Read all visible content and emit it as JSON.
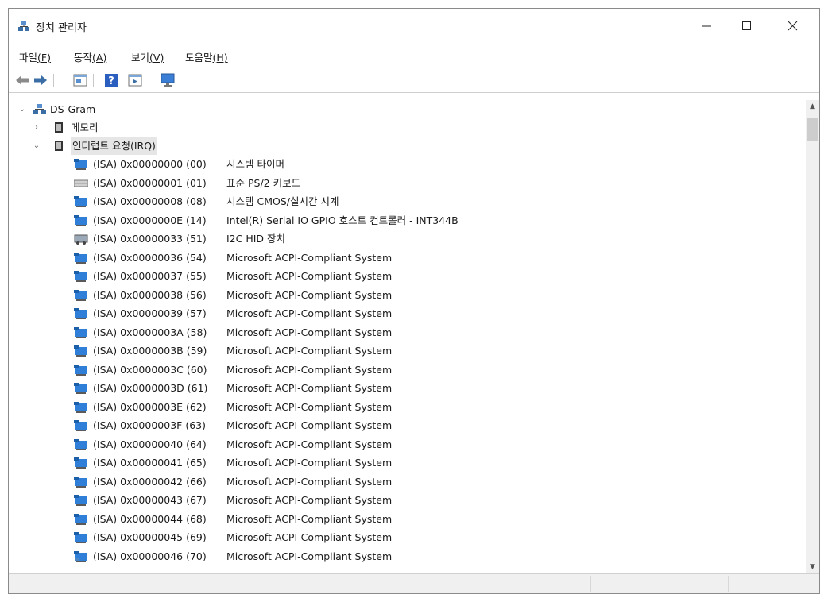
{
  "window": {
    "title": "장치 관리자",
    "icon": "computer-icon"
  },
  "menu": [
    {
      "label": "파일",
      "accel": "(F)"
    },
    {
      "label": "동작",
      "accel": "(A)"
    },
    {
      "label": "보기",
      "accel": "(V)"
    },
    {
      "label": "도움말",
      "accel": "(H)"
    }
  ],
  "toolbar": [
    "back-icon",
    "forward-icon",
    "properties-icon",
    "help-icon",
    "view-icon",
    "monitor-icon"
  ],
  "tree": {
    "root": "DS-Gram",
    "nodes": [
      {
        "label": "메모리",
        "expanded": false
      },
      {
        "label": "인터럽트 요청(IRQ)",
        "expanded": true,
        "selected": true
      }
    ],
    "irq": [
      {
        "irq": "(ISA) 0x00000000 (00)",
        "device": "시스템 타이머",
        "icon": "monitor"
      },
      {
        "irq": "(ISA) 0x00000001 (01)",
        "device": "표준 PS/2 키보드",
        "icon": "keyboard"
      },
      {
        "irq": "(ISA) 0x00000008 (08)",
        "device": "시스템 CMOS/실시간 시계",
        "icon": "monitor"
      },
      {
        "irq": "(ISA) 0x0000000E (14)",
        "device": "Intel(R) Serial IO GPIO 호스트 컨트롤러 - INT344B",
        "icon": "monitor"
      },
      {
        "irq": "(ISA) 0x00000033 (51)",
        "device": "I2C HID 장치",
        "icon": "hid"
      },
      {
        "irq": "(ISA) 0x00000036 (54)",
        "device": "Microsoft ACPI-Compliant System",
        "icon": "monitor"
      },
      {
        "irq": "(ISA) 0x00000037 (55)",
        "device": "Microsoft ACPI-Compliant System",
        "icon": "monitor"
      },
      {
        "irq": "(ISA) 0x00000038 (56)",
        "device": "Microsoft ACPI-Compliant System",
        "icon": "monitor"
      },
      {
        "irq": "(ISA) 0x00000039 (57)",
        "device": "Microsoft ACPI-Compliant System",
        "icon": "monitor"
      },
      {
        "irq": "(ISA) 0x0000003A (58)",
        "device": "Microsoft ACPI-Compliant System",
        "icon": "monitor"
      },
      {
        "irq": "(ISA) 0x0000003B (59)",
        "device": "Microsoft ACPI-Compliant System",
        "icon": "monitor"
      },
      {
        "irq": "(ISA) 0x0000003C (60)",
        "device": "Microsoft ACPI-Compliant System",
        "icon": "monitor"
      },
      {
        "irq": "(ISA) 0x0000003D (61)",
        "device": "Microsoft ACPI-Compliant System",
        "icon": "monitor"
      },
      {
        "irq": "(ISA) 0x0000003E (62)",
        "device": "Microsoft ACPI-Compliant System",
        "icon": "monitor"
      },
      {
        "irq": "(ISA) 0x0000003F (63)",
        "device": "Microsoft ACPI-Compliant System",
        "icon": "monitor"
      },
      {
        "irq": "(ISA) 0x00000040 (64)",
        "device": "Microsoft ACPI-Compliant System",
        "icon": "monitor"
      },
      {
        "irq": "(ISA) 0x00000041 (65)",
        "device": "Microsoft ACPI-Compliant System",
        "icon": "monitor"
      },
      {
        "irq": "(ISA) 0x00000042 (66)",
        "device": "Microsoft ACPI-Compliant System",
        "icon": "monitor"
      },
      {
        "irq": "(ISA) 0x00000043 (67)",
        "device": "Microsoft ACPI-Compliant System",
        "icon": "monitor"
      },
      {
        "irq": "(ISA) 0x00000044 (68)",
        "device": "Microsoft ACPI-Compliant System",
        "icon": "monitor"
      },
      {
        "irq": "(ISA) 0x00000045 (69)",
        "device": "Microsoft ACPI-Compliant System",
        "icon": "monitor"
      },
      {
        "irq": "(ISA) 0x00000046 (70)",
        "device": "Microsoft ACPI-Compliant System",
        "icon": "monitor"
      }
    ]
  },
  "colors": {
    "accent": "#1e88e5",
    "selection": "#e6e6e6"
  }
}
